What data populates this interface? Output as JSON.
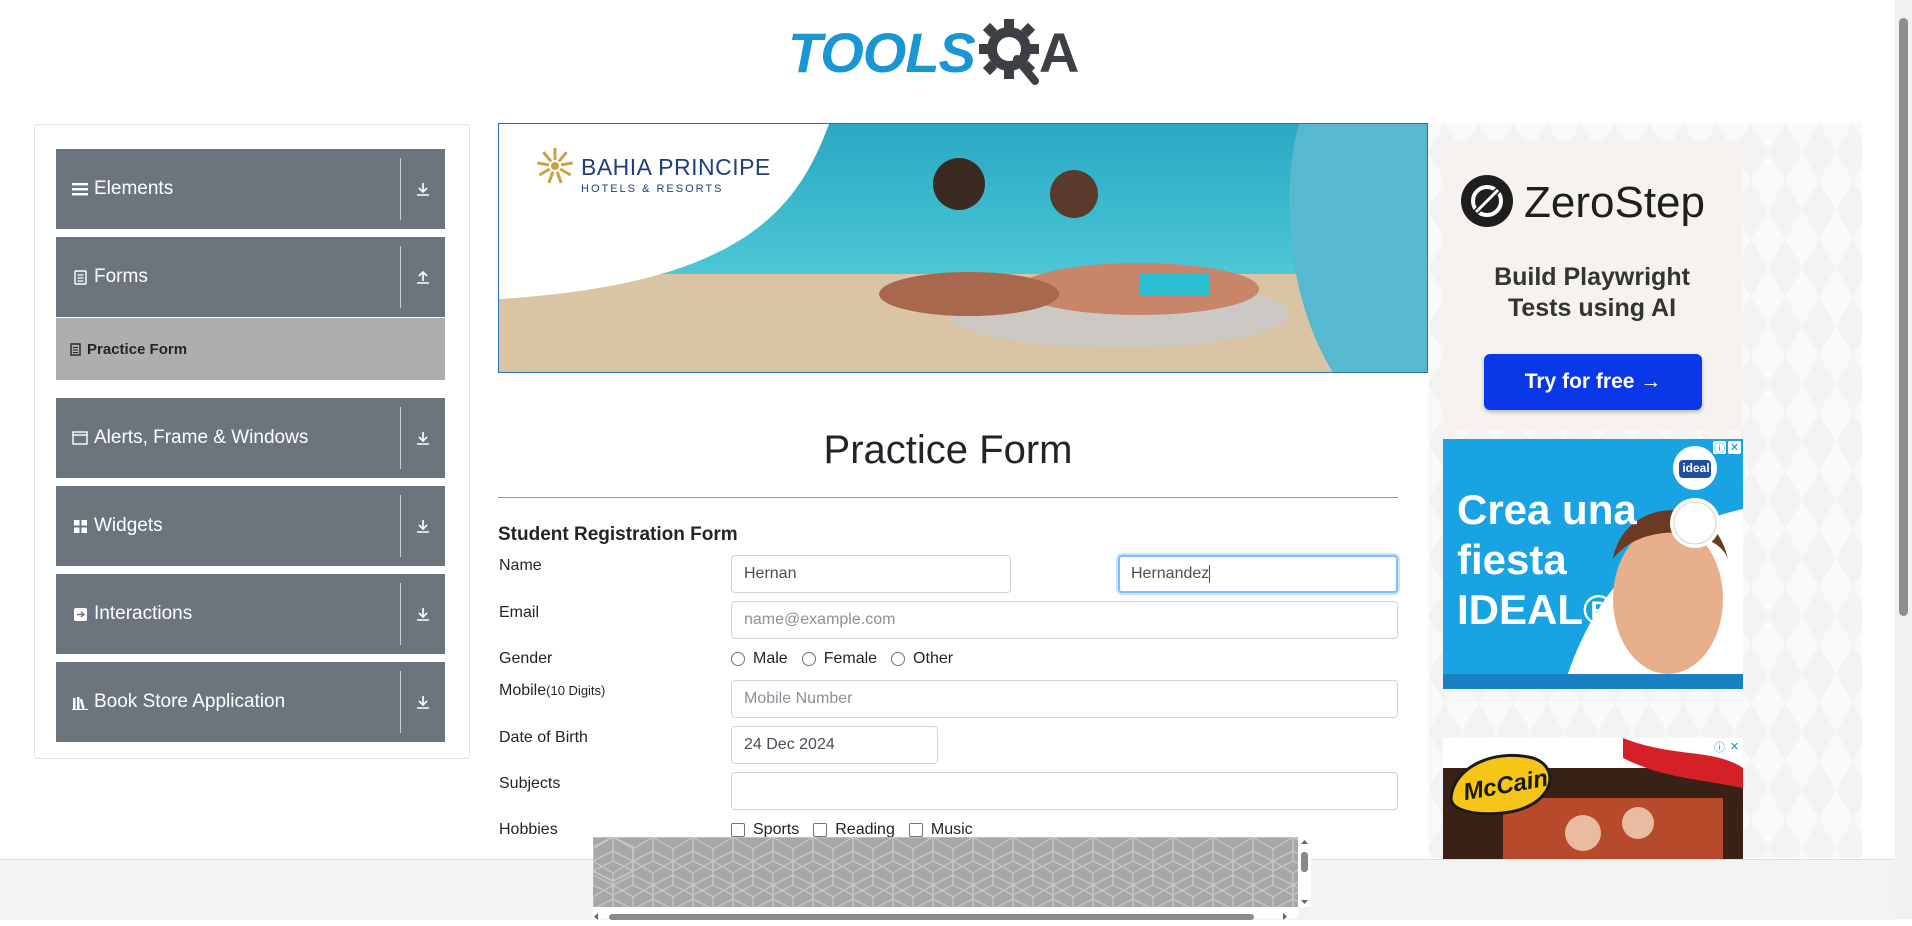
{
  "logo": {
    "text_part": "TOOLS",
    "letter_part": "A",
    "colors": {
      "blue": "#1a96d4",
      "dark": "#3c3f44"
    }
  },
  "sidebar": {
    "groups": [
      {
        "label": "Elements",
        "icon": "hamburger-icon",
        "state": "collapsed"
      },
      {
        "label": "Forms",
        "icon": "document-icon",
        "state": "expanded"
      },
      {
        "label": "Alerts, Frame & Windows",
        "icon": "window-icon",
        "state": "collapsed"
      },
      {
        "label": "Widgets",
        "icon": "grid-icon",
        "state": "collapsed"
      },
      {
        "label": "Interactions",
        "icon": "interaction-icon",
        "state": "collapsed"
      },
      {
        "label": "Book Store Application",
        "icon": "books-icon",
        "state": "collapsed"
      }
    ],
    "active_item": {
      "label": "Practice Form",
      "icon": "form-icon"
    },
    "colors": {
      "group_bg": "#6c757d",
      "active_bg": "#aeaeae"
    }
  },
  "banner_ad": {
    "brand": "BAHIA PRINCIPE",
    "subtitle": "HOTELS & RESORTS"
  },
  "ads": {
    "zerostep": {
      "brand": "ZeroStep",
      "tagline_line1": "Build Playwright",
      "tagline_line2": "Tests using AI",
      "cta": "Try for free →"
    },
    "ideal": {
      "headline_line1": "Crea una",
      "headline_line2": "fiesta",
      "headline_line3": "IDEAL®",
      "logo_text": "ideal"
    },
    "mccain": {
      "logo_text": "McCain"
    }
  },
  "form": {
    "page_title": "Practice Form",
    "section_title": "Student Registration Form",
    "name": {
      "label": "Name",
      "first_value": "Hernan",
      "last_value": "Hernandez"
    },
    "email": {
      "label": "Email",
      "placeholder": "name@example.com"
    },
    "gender": {
      "label": "Gender",
      "options": [
        "Male",
        "Female",
        "Other"
      ]
    },
    "mobile": {
      "label": "Mobile",
      "hint": "(10 Digits)",
      "placeholder": "Mobile Number"
    },
    "dob": {
      "label": "Date of Birth",
      "value": "24 Dec 2024"
    },
    "subjects": {
      "label": "Subjects",
      "value": ""
    },
    "hobbies": {
      "label": "Hobbies",
      "options": [
        "Sports",
        "Reading",
        "Music"
      ]
    }
  }
}
